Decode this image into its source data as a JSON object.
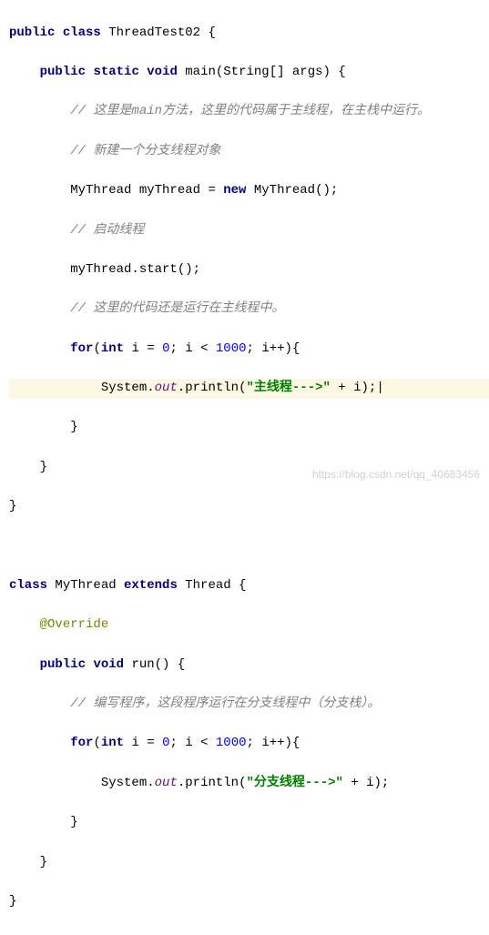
{
  "code": {
    "l1_kw1": "public",
    "l1_kw2": "class",
    "l1_cls": " ThreadTest02 {",
    "l2_kw1": "public",
    "l2_kw2": "static",
    "l2_kw3": "void",
    "l2_rest": " main(String[] args) {",
    "l3_cmt": "// 这里是main方法，这里的代码属于主线程，在主栈中运行。",
    "l4_cmt": "// 新建一个分支线程对象",
    "l5_a": "MyThread myThread = ",
    "l5_kw": "new",
    "l5_b": " MyThread();",
    "l6_cmt": "// 启动线程",
    "l7": "myThread.start();",
    "l8_cmt": "// 这里的代码还是运行在主线程中。",
    "l9_kw1": "for",
    "l9_a": "(",
    "l9_kw2": "int",
    "l9_b": " i = ",
    "l9_n1": "0",
    "l9_c": "; i < ",
    "l9_n2": "1000",
    "l9_d": "; i++){",
    "l10_a": "System.",
    "l10_out": "out",
    "l10_b": ".println(",
    "l10_str": "\"主线程--->\"",
    "l10_c": " + i);",
    "l10_caret": "|",
    "l11": "}",
    "l12": "}",
    "l13": "}",
    "l15_kw1": "class",
    "l15_a": " MyThread ",
    "l15_kw2": "extends",
    "l15_b": " Thread {",
    "l16_ann": "@Override",
    "l17_kw1": "public",
    "l17_kw2": "void",
    "l17_rest": " run() {",
    "l18_cmt": "// 编写程序，这段程序运行在分支线程中（分支栈）。",
    "l19_kw1": "for",
    "l19_a": "(",
    "l19_kw2": "int",
    "l19_b": " i = ",
    "l19_n1": "0",
    "l19_c": "; i < ",
    "l19_n2": "1000",
    "l19_d": "; i++){",
    "l20_a": "System.",
    "l20_out": "out",
    "l20_b": ".println(",
    "l20_str": "\"分支线程--->\"",
    "l20_c": " + i);",
    "l21": "}",
    "l22": "}",
    "l23": "}"
  },
  "watermark": "https://blog.csdn.net/qq_40683456"
}
